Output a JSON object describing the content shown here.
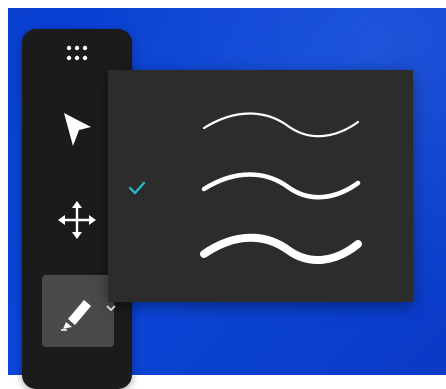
{
  "toolbar": {
    "tools": [
      {
        "name": "grip",
        "icon": "grip-dots-icon",
        "selected": false
      },
      {
        "name": "select",
        "icon": "arrow-cursor-icon",
        "selected": false
      },
      {
        "name": "move",
        "icon": "move-arrows-icon",
        "selected": false
      },
      {
        "name": "pen",
        "icon": "pen-icon",
        "selected": true,
        "has_dropdown": true
      }
    ]
  },
  "stroke_popup": {
    "options": [
      {
        "id": "thin",
        "selected": false
      },
      {
        "id": "medium",
        "selected": true
      },
      {
        "id": "thick",
        "selected": false
      }
    ],
    "check_icon": "checkmark-icon"
  },
  "colors": {
    "background": "#0b46d8",
    "toolbar": "#1b1b1b",
    "popup": "#2c2c2c",
    "selected_tool": "#4a4a4a",
    "icon": "#ffffff",
    "check": "#2bb3c9"
  }
}
